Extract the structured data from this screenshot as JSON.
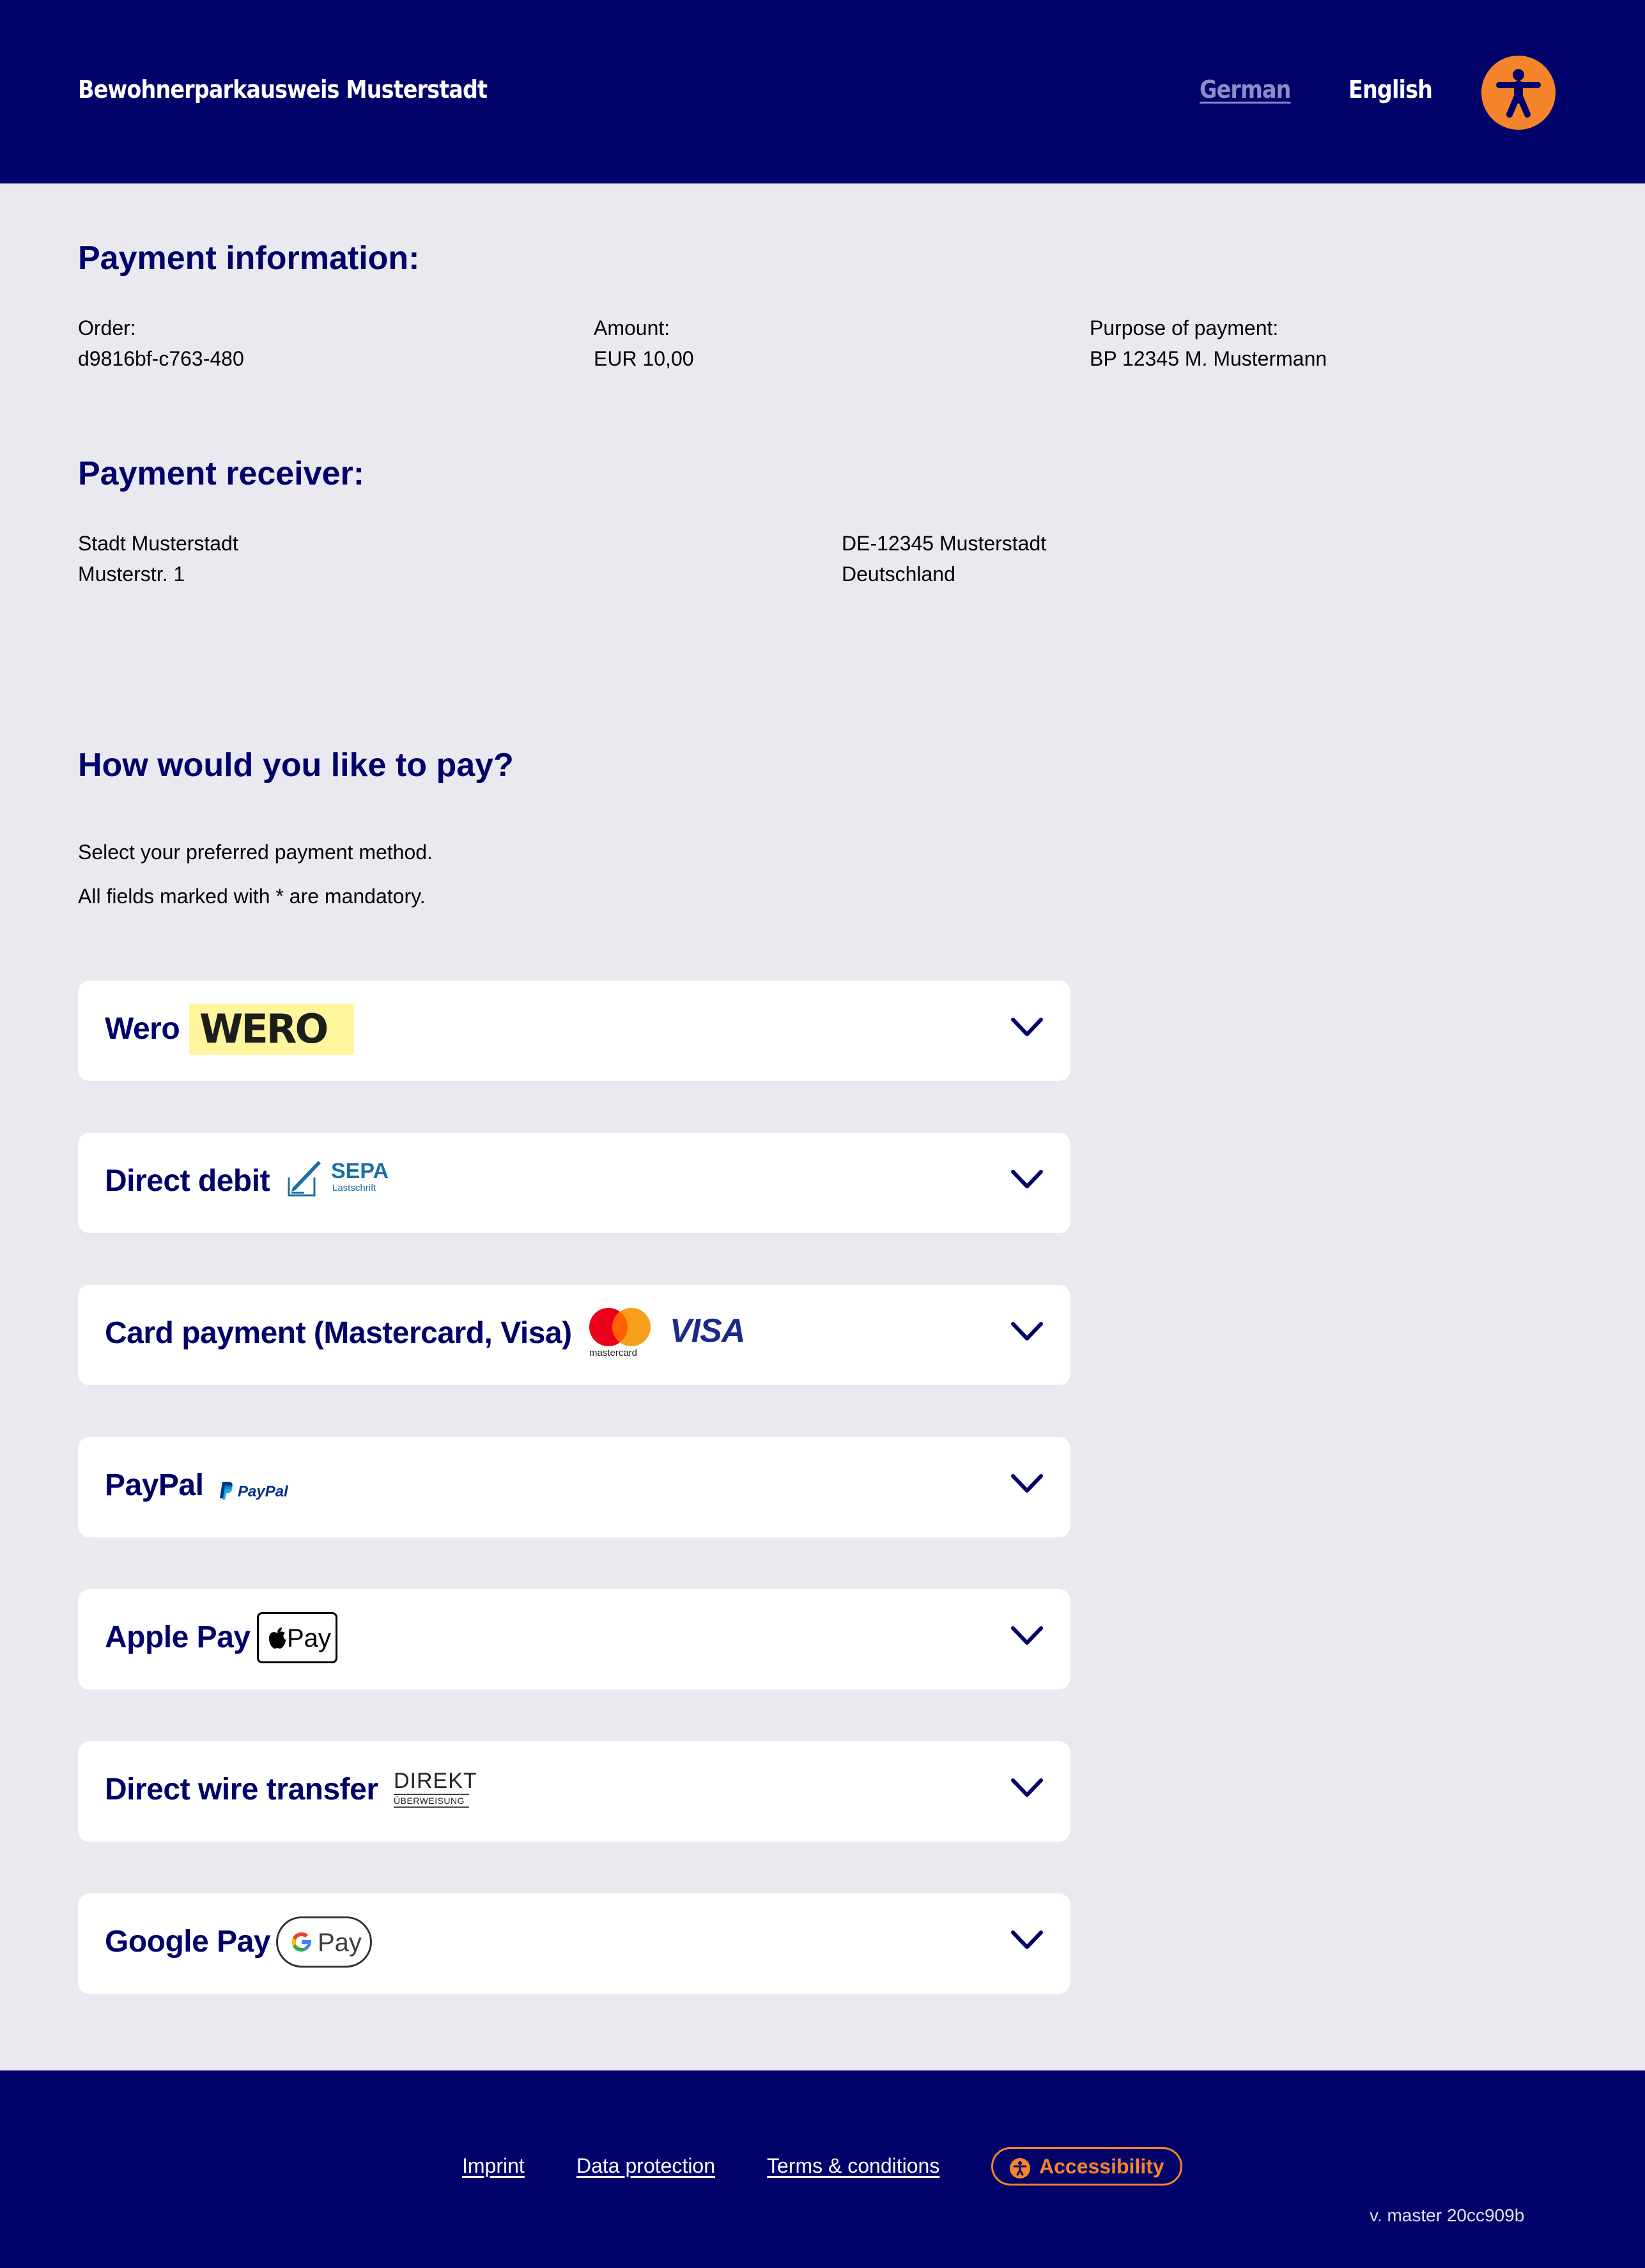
{
  "header": {
    "site_title": "Bewohnerparkausweis Musterstadt",
    "lang_german": "German",
    "lang_english": "English",
    "accessibility_icon": "accessibility-person-icon"
  },
  "payment_information": {
    "heading": "Payment information:",
    "order_label": "Order:",
    "order_value": "d9816bf-c763-480",
    "amount_label": "Amount:",
    "amount_value": "EUR 10,00",
    "purpose_label": "Purpose of payment:",
    "purpose_value": "BP 12345 M. Mustermann"
  },
  "payment_receiver": {
    "heading": "Payment receiver:",
    "line1": "Stadt Musterstadt",
    "line2": "Musterstr. 1",
    "line3": "DE-12345 Musterstadt",
    "line4": "Deutschland"
  },
  "payment_method": {
    "heading": "How would you like to pay?",
    "instruction": "Select your preferred payment method.",
    "mandatory_note": "All fields marked with * are mandatory.",
    "methods": [
      {
        "label": "Wero",
        "logo_text": "WERO"
      },
      {
        "label": "Direct debit",
        "logo_text": "SEPA",
        "logo_sub": "Lastschrift"
      },
      {
        "label": "Card payment (Mastercard, Visa)",
        "logo_text": "mastercard",
        "logo_text2": "VISA"
      },
      {
        "label": "PayPal",
        "logo_text": "PayPal"
      },
      {
        "label": "Apple Pay",
        "logo_text": "Pay"
      },
      {
        "label": "Direct wire transfer",
        "logo_text": "DIREKT",
        "logo_sub": "ÜBERWEISUNG"
      },
      {
        "label": "Google Pay",
        "logo_text": "Pay"
      }
    ]
  },
  "footer": {
    "imprint": "Imprint",
    "data_protection": "Data protection",
    "terms": "Terms & conditions",
    "accessibility": "Accessibility",
    "version": "v. master 20cc909b"
  },
  "colors": {
    "navy": "#01016a",
    "orange": "#f5852a",
    "background": "#eae9f0"
  }
}
